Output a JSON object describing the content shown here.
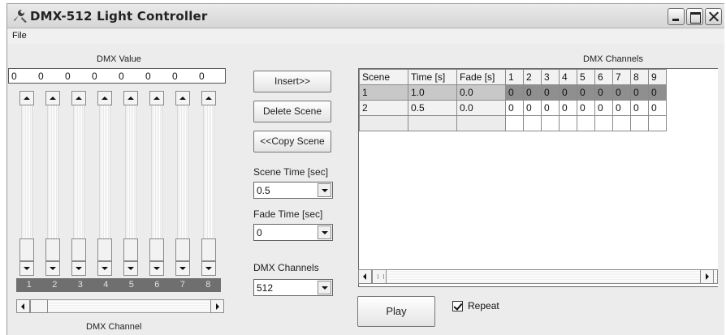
{
  "window": {
    "title": "DMX-512 Light Controller",
    "app_icon": "wrench-icon",
    "buttons": [
      "minimize-icon",
      "maximize-icon",
      "close-icon"
    ]
  },
  "menu": {
    "file": "File"
  },
  "left_panel": {
    "value_label": "DMX Value",
    "values": [
      "0",
      "0",
      "0",
      "0",
      "0",
      "0",
      "0",
      "0"
    ],
    "channel_numbers": [
      "1",
      "2",
      "3",
      "4",
      "5",
      "6",
      "7",
      "8"
    ],
    "channel_label": "DMX Channel",
    "slider_levels": [
      0,
      0,
      0,
      0,
      0,
      0,
      0,
      0
    ]
  },
  "actions": {
    "insert": "Insert>>",
    "delete": "Delete Scene",
    "copy": "<<Copy Scene",
    "scene_time_label": "Scene Time [sec]",
    "scene_time_value": "0.5",
    "fade_time_label": "Fade Time [sec]",
    "fade_time_value": "0",
    "channels_label": "DMX Channels",
    "channels_value": "512"
  },
  "grid": {
    "title": "DMX Channels",
    "headers": [
      "Scene",
      "Time [s]",
      "Fade [s]",
      "1",
      "2",
      "3",
      "4",
      "5",
      "6",
      "7",
      "8",
      "9"
    ],
    "rows": [
      {
        "selected": true,
        "cells": [
          "1",
          "1.0",
          "0.0",
          "0",
          "0",
          "0",
          "0",
          "0",
          "0",
          "0",
          "0",
          "0"
        ]
      },
      {
        "selected": false,
        "cells": [
          "2",
          "0.5",
          "0.0",
          "0",
          "0",
          "0",
          "0",
          "0",
          "0",
          "0",
          "0",
          "0"
        ]
      }
    ]
  },
  "bottom": {
    "play": "Play",
    "repeat_label": "Repeat",
    "repeat_checked": true
  },
  "colors": {
    "window_bg": "#ececec",
    "selected_row": "#8f8f8f",
    "channel_strip": "#6f6f6f"
  }
}
